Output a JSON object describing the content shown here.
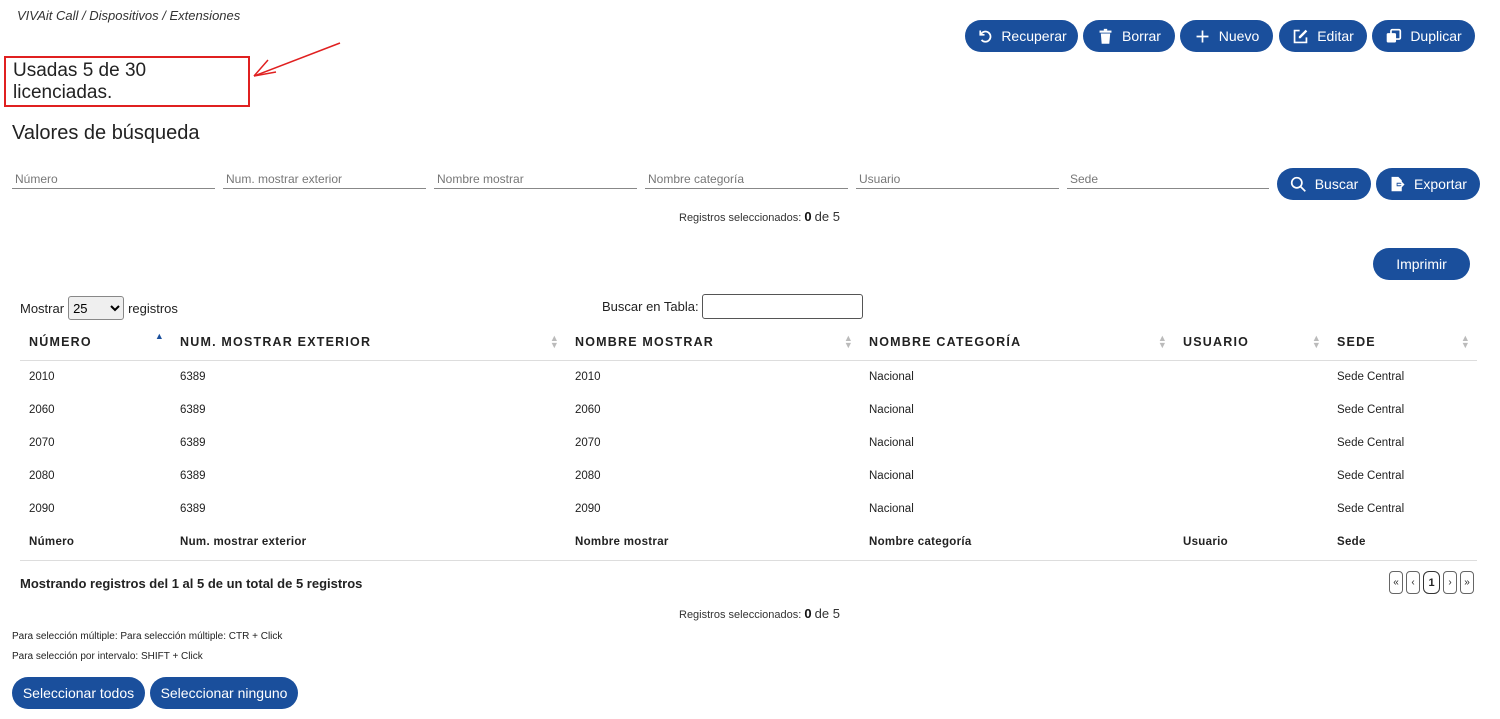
{
  "breadcrumb": "VIVAit Call / Dispositivos / Extensiones",
  "toolbar": {
    "recuperar": "Recuperar",
    "borrar": "Borrar",
    "nuevo": "Nuevo",
    "editar": "Editar",
    "duplicar": "Duplicar"
  },
  "license_text": "Usadas 5 de 30 licenciadas.",
  "search_title": "Valores de búsqueda",
  "filters": {
    "numero": "Número",
    "num_exterior": "Num. mostrar exterior",
    "nombre_mostrar": "Nombre mostrar",
    "nombre_categoria": "Nombre categoría",
    "usuario": "Usuario",
    "sede": "Sede"
  },
  "search_button": "Buscar",
  "export_button": "Exportar",
  "print_button": "Imprimir",
  "selected": {
    "label": "Registros seleccionados:",
    "count": "0",
    "of": "de 5"
  },
  "show": {
    "label": "Mostrar",
    "value": "25",
    "suffix": "registros"
  },
  "table_search_label": "Buscar en Tabla:",
  "table": {
    "headers": [
      "NÚMERO",
      "NUM. MOSTRAR EXTERIOR",
      "NOMBRE MOSTRAR",
      "NOMBRE CATEGORÍA",
      "USUARIO",
      "SEDE"
    ],
    "rows": [
      [
        "2010",
        "6389",
        "2010",
        "Nacional",
        "",
        "Sede Central"
      ],
      [
        "2060",
        "6389",
        "2060",
        "Nacional",
        "",
        "Sede Central"
      ],
      [
        "2070",
        "6389",
        "2070",
        "Nacional",
        "",
        "Sede Central"
      ],
      [
        "2080",
        "6389",
        "2080",
        "Nacional",
        "",
        "Sede Central"
      ],
      [
        "2090",
        "6389",
        "2090",
        "Nacional",
        "",
        "Sede Central"
      ]
    ],
    "footers": [
      "Número",
      "Num. mostrar exterior",
      "Nombre mostrar",
      "Nombre categoría",
      "Usuario",
      "Sede"
    ]
  },
  "summary": "Mostrando registros del 1 al 5 de un total de 5 registros",
  "pagination": {
    "first": "«",
    "prev": "‹",
    "current": "1",
    "next": "›",
    "last": "»"
  },
  "help": {
    "multi": "Para selección múltiple: Para selección múltiple: CTR + Click",
    "interval": "Para selección por intervalo: SHIFT + Click"
  },
  "select_all": "Seleccionar todos",
  "select_none": "Seleccionar ninguno",
  "colors": {
    "primary": "#1a4f9c",
    "highlight": "#e02020"
  }
}
